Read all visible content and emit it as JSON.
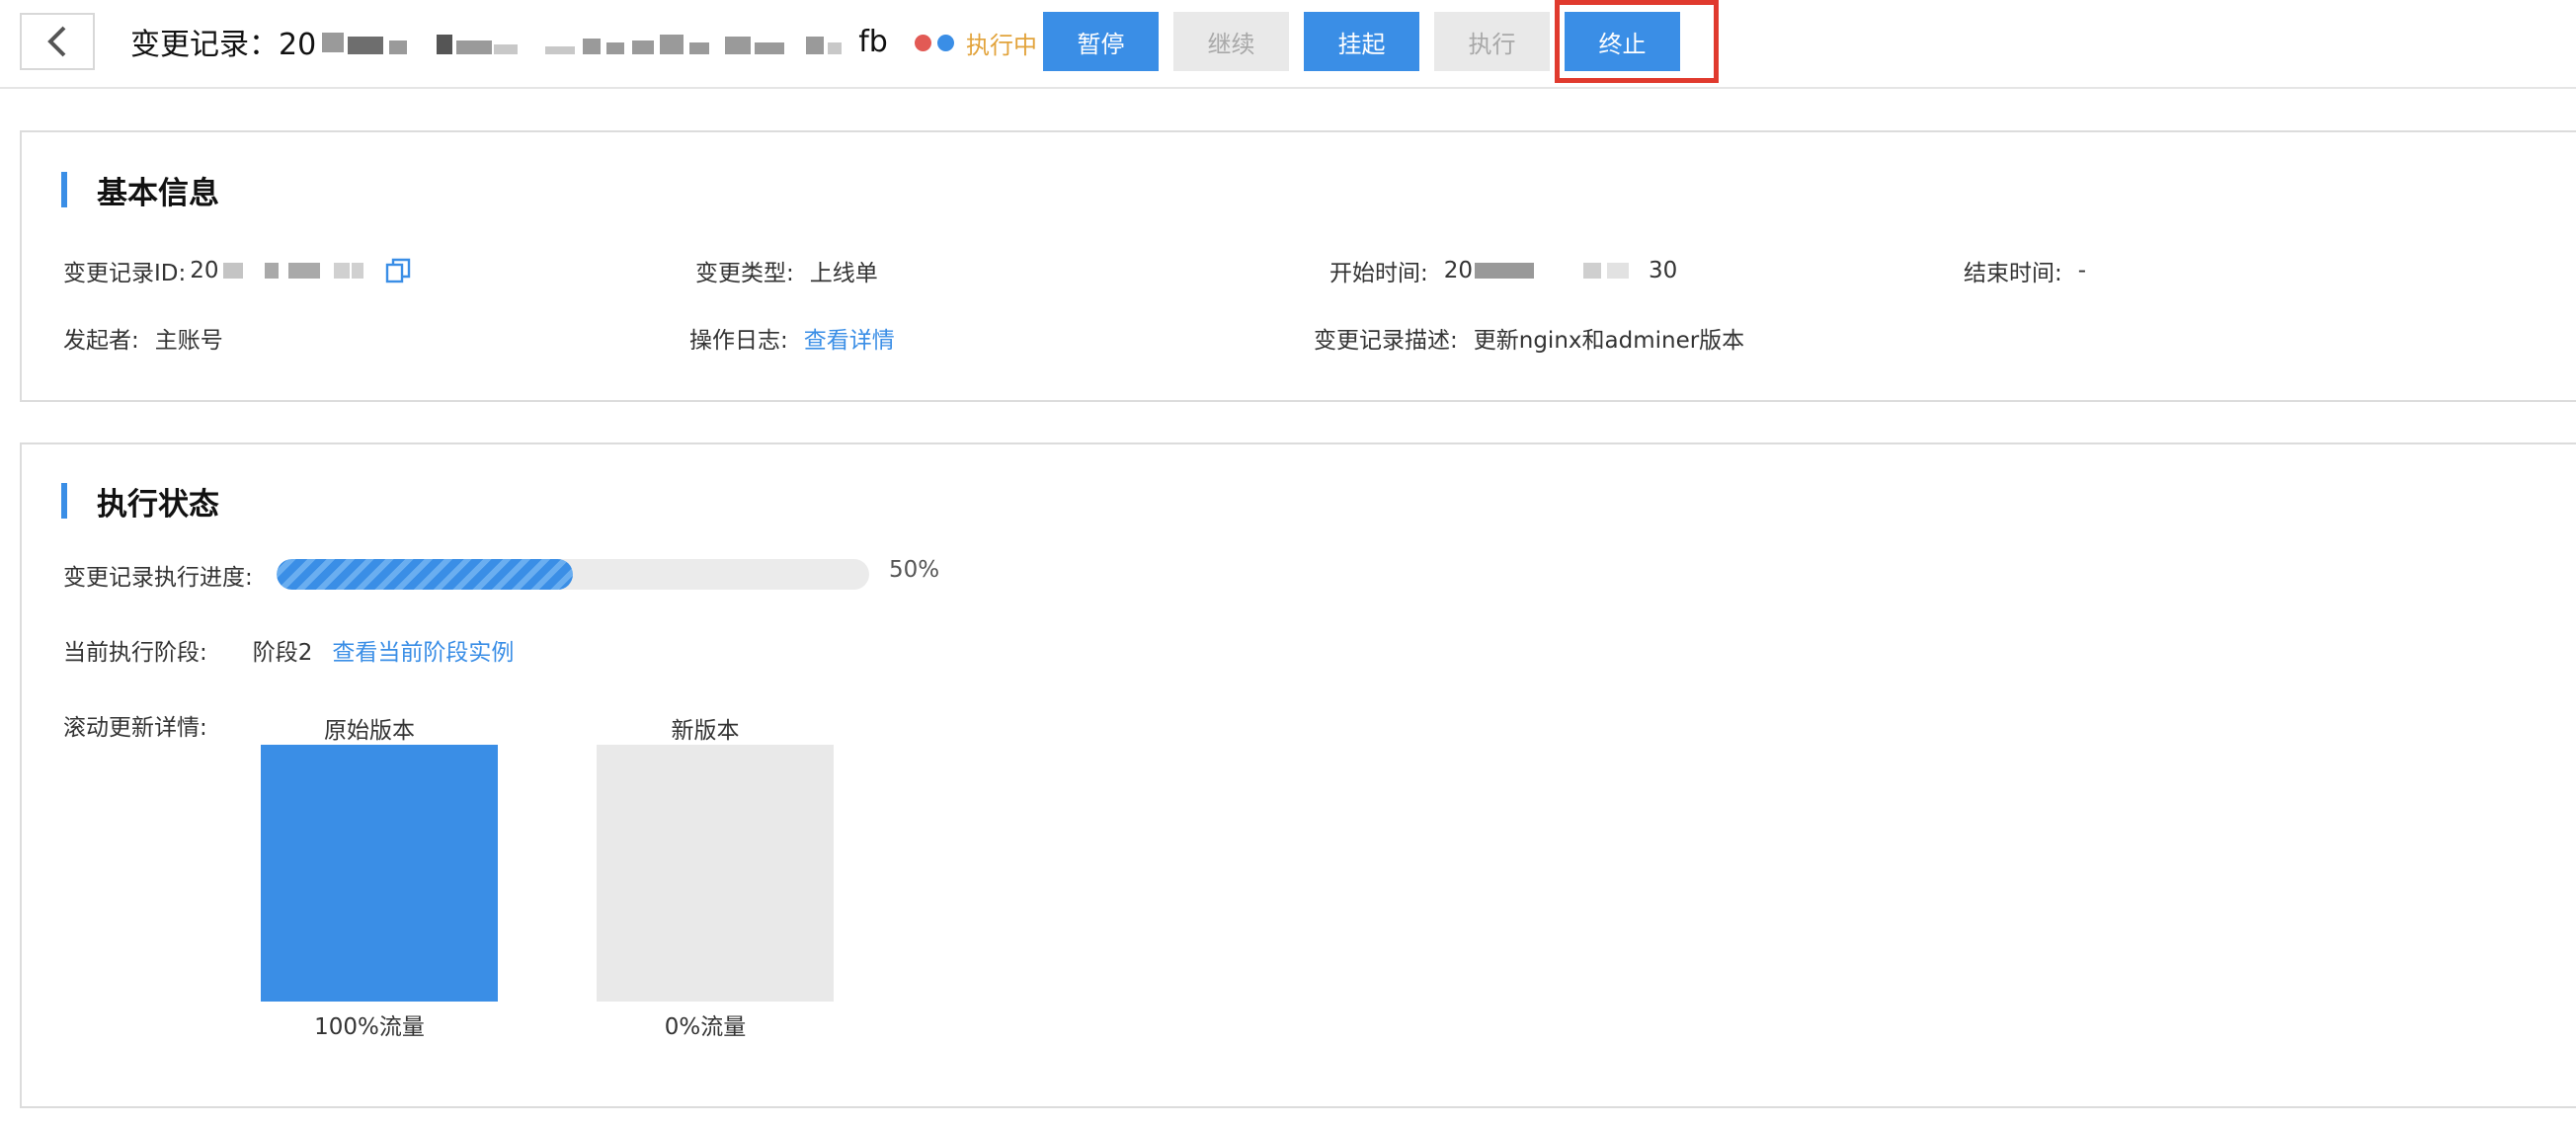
{
  "header": {
    "title_prefix": "变更记录：20",
    "title_suffix": "fb",
    "status_text": "执行中",
    "buttons": {
      "pause": "暂停",
      "resume": "继续",
      "suspend": "挂起",
      "execute": "执行",
      "terminate": "终止"
    }
  },
  "basic_info": {
    "title": "基本信息",
    "record_id_label": "变更记录ID:",
    "record_id_value": "20",
    "change_type_label": "变更类型:",
    "change_type_value": "上线单",
    "start_time_label": "开始时间:",
    "start_time_prefix": "20",
    "start_time_suffix": "30",
    "end_time_label": "结束时间:",
    "end_time_value": "-",
    "initiator_label": "发起者:",
    "initiator_value": "主账号",
    "op_log_label": "操作日志:",
    "op_log_link": "查看详情",
    "description_label": "变更记录描述:",
    "description_value": "更新nginx和adminer版本"
  },
  "exec_status": {
    "title": "执行状态",
    "progress_label": "变更记录执行进度:",
    "progress_percent": 50,
    "progress_text": "50%",
    "stage_label": "当前执行阶段:",
    "stage_value": "阶段2",
    "stage_link": "查看当前阶段实例",
    "rolling_label": "滚动更新详情:",
    "original_version": {
      "title": "原始版本",
      "traffic_text": "100%流量",
      "traffic_fraction": 1.0,
      "color": "#3a8ee6"
    },
    "new_version": {
      "title": "新版本",
      "traffic_text": "0%流量",
      "traffic_fraction": 0.0,
      "color": "#e9e9e9"
    }
  },
  "colors": {
    "primary": "#3a8ee6",
    "status_running": "#e2a33b",
    "highlight": "#e03a2e",
    "disabled_bg": "#e9e9e9"
  }
}
